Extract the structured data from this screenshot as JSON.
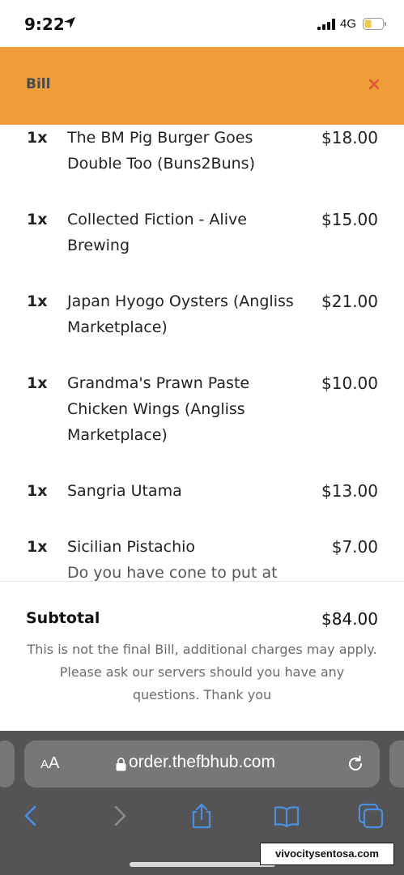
{
  "status_bar": {
    "time": "9:22",
    "network": "4G",
    "location_icon": "location-arrow-icon",
    "signal_icon": "cellular-signal-icon",
    "battery_icon": "battery-low-icon",
    "battery_color": "#f2c94c"
  },
  "header": {
    "title": "Bill",
    "close_label": "×",
    "background": "#ef9d38",
    "close_color": "#e0533a"
  },
  "items": [
    {
      "qty": "1x",
      "name": "The BM Pig Burger Goes Double Too (Buns2Buns)",
      "price": "$18.00"
    },
    {
      "qty": "1x",
      "name": "Collected Fiction - Alive Brewing",
      "price": "$15.00"
    },
    {
      "qty": "1x",
      "name": "Japan Hyogo Oysters (Angliss Marketplace)",
      "price": "$21.00"
    },
    {
      "qty": "1x",
      "name": "Grandma's Prawn Paste Chicken Wings (Angliss Marketplace)",
      "price": "$10.00"
    },
    {
      "qty": "1x",
      "name": "Sangria Utama",
      "price": "$13.00"
    },
    {
      "qty": "1x",
      "name": "Sicilian Pistachio",
      "note": "Do you have cone to put at the",
      "price": "$7.00"
    }
  ],
  "summary": {
    "subtotal_label": "Subtotal",
    "subtotal_value": "$84.00",
    "disclaimer": "This is not the final Bill, additional charges may apply. Please ask our servers should you have any questions. Thank you"
  },
  "browser": {
    "text_size_label_small": "A",
    "text_size_label_large": "A",
    "url": "order.thefbhub.com",
    "lock_icon": "lock-icon",
    "reload_icon": "reload-icon",
    "toolbar": [
      "back-icon",
      "forward-icon",
      "share-icon",
      "bookmarks-icon",
      "tabs-icon"
    ],
    "accent": "#4a90e2"
  },
  "watermark": {
    "text": "vivocitysentosa.com"
  }
}
